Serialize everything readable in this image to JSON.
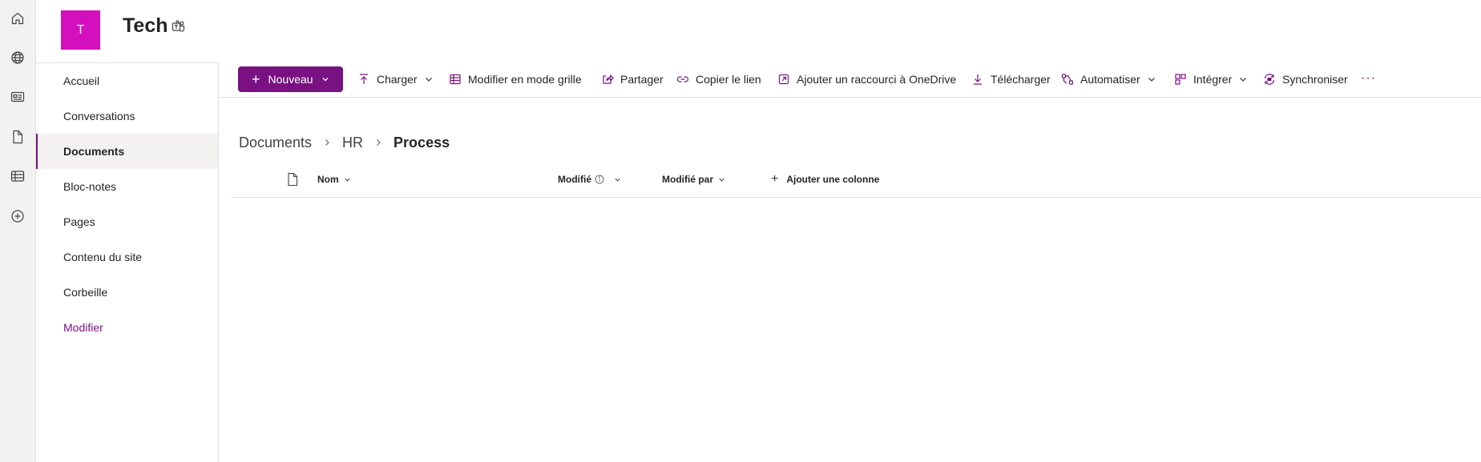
{
  "site": {
    "logo_letter": "T",
    "title": "Tech"
  },
  "rail": {
    "icons": [
      "home-icon",
      "globe-icon",
      "news-icon",
      "document-icon",
      "list-icon",
      "add-circle-icon"
    ]
  },
  "nav": {
    "items": [
      {
        "label": "Accueil"
      },
      {
        "label": "Conversations"
      },
      {
        "label": "Documents",
        "active": true
      },
      {
        "label": "Bloc-notes"
      },
      {
        "label": "Pages"
      },
      {
        "label": "Contenu du site"
      },
      {
        "label": "Corbeille"
      }
    ],
    "edit_label": "Modifier"
  },
  "toolbar": {
    "new_label": "Nouveau",
    "upload_label": "Charger",
    "grid_edit_label": "Modifier en mode grille",
    "share_label": "Partager",
    "copy_link_label": "Copier le lien",
    "onedrive_shortcut_label": "Ajouter un raccourci à OneDrive",
    "download_label": "Télécharger",
    "automate_label": "Automatiser",
    "integrate_label": "Intégrer",
    "sync_label": "Synchroniser",
    "more_label": "···"
  },
  "breadcrumb": {
    "items": [
      "Documents",
      "HR"
    ],
    "current": "Process"
  },
  "columns": {
    "name": "Nom",
    "modified": "Modifié",
    "modified_by": "Modifié par",
    "add_column": "Ajouter une colonne"
  },
  "colors": {
    "accent": "#7a1183",
    "site_logo": "#d40fbd"
  }
}
